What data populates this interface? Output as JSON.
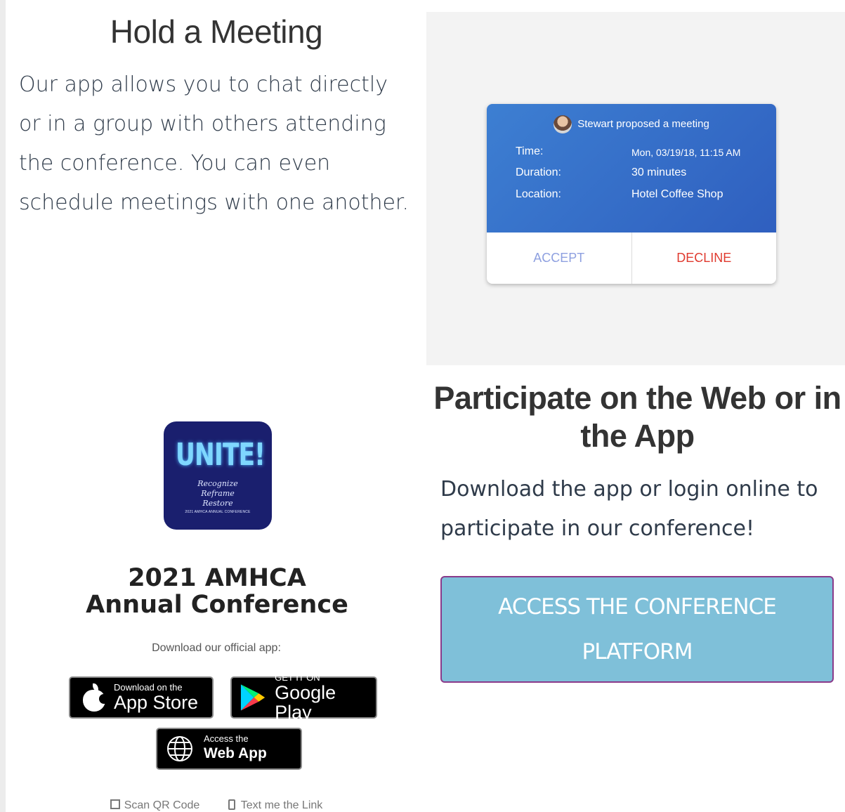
{
  "meeting_section": {
    "title": "Hold a Meeting",
    "description": "Our app allows you to chat directly or in a group with others attending the conference. You can even schedule meetings with one another.",
    "card": {
      "header": "Stewart proposed a meeting",
      "rows": [
        {
          "label": "Time:",
          "value": "Mon, 03/19/18, 11:15 AM"
        },
        {
          "label": "Duration:",
          "value": "30 minutes"
        },
        {
          "label": "Location:",
          "value": "Hotel Coffee Shop"
        }
      ],
      "accept_label": "ACCEPT",
      "decline_label": "DECLINE"
    }
  },
  "app_panel": {
    "logo": {
      "big": "UNITE!",
      "line1": "Recognize",
      "line2": "Reframe",
      "line3": "Restore",
      "small": "2021 AMHCA ANNUAL CONFERENCE"
    },
    "title": "2021 AMHCA Annual Conference",
    "subtitle": "Download our official app:",
    "appstore": {
      "small": "Download on the",
      "big": "App Store"
    },
    "google": {
      "small": "GET IT ON",
      "big": "Google Play"
    },
    "webapp": {
      "small": "Access the",
      "big": "Web App"
    },
    "scan_qr": "Scan QR Code",
    "text_link": "Text me the Link"
  },
  "web_section": {
    "title": "Participate on the Web or in the App",
    "description": "Download the app or login online to participate in our conference!",
    "cta_label": "ACCESS THE CONFERENCE PLATFORM"
  },
  "colors": {
    "card_blue": "#3d7fd2",
    "decline_red": "#e03a2f",
    "cta_bg": "#7fc0d9",
    "cta_border": "#8a3a8a",
    "logo_bg": "#1a1f6e"
  }
}
